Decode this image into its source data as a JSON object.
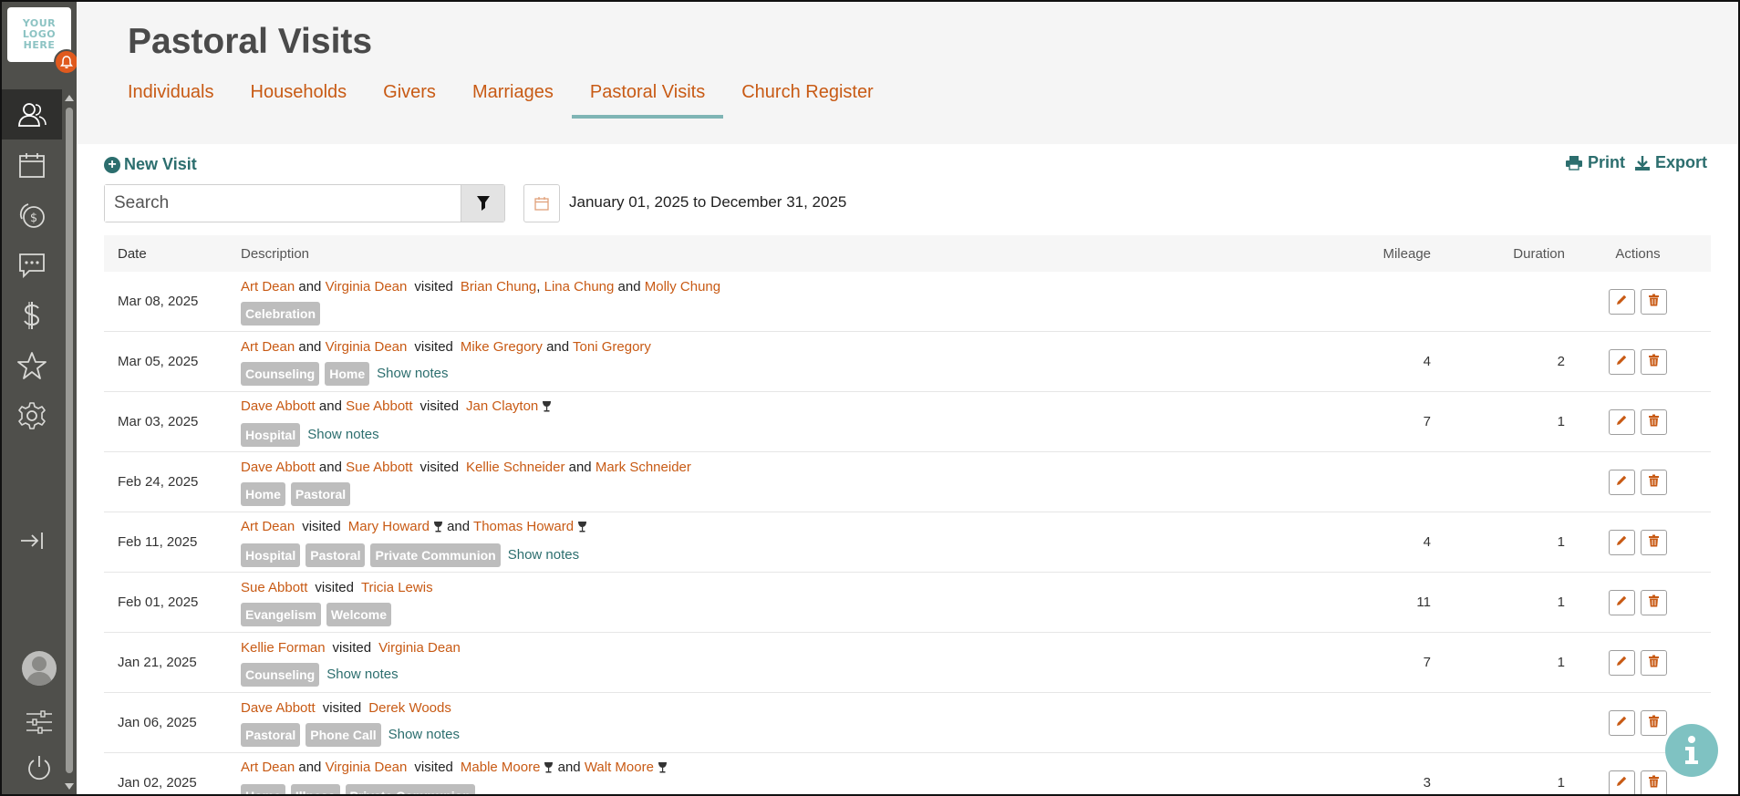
{
  "app": {
    "logo_lines": [
      "YOUR",
      "LOGO",
      "HERE"
    ]
  },
  "sidebar": {
    "items": [
      {
        "name": "people",
        "icon": "people-icon",
        "active": true
      },
      {
        "name": "calendar",
        "icon": "calendar-icon",
        "active": false
      },
      {
        "name": "giving",
        "icon": "coins-icon",
        "active": false
      },
      {
        "name": "messages",
        "icon": "chat-icon",
        "active": false
      },
      {
        "name": "finance",
        "icon": "dollar-icon",
        "active": false
      },
      {
        "name": "favorites",
        "icon": "star-icon",
        "active": false
      },
      {
        "name": "settings",
        "icon": "gear-icon",
        "active": false
      }
    ]
  },
  "header": {
    "title": "Pastoral Visits",
    "tabs": [
      {
        "label": "Individuals",
        "active": false
      },
      {
        "label": "Households",
        "active": false
      },
      {
        "label": "Givers",
        "active": false
      },
      {
        "label": "Marriages",
        "active": false
      },
      {
        "label": "Pastoral Visits",
        "active": true
      },
      {
        "label": "Church Register",
        "active": false
      }
    ]
  },
  "toolbar": {
    "new_visit_label": "New Visit",
    "print_label": "Print",
    "export_label": "Export",
    "search_placeholder": "Search",
    "date_from": "January 01, 2025",
    "date_to_word": "to",
    "date_to": "December 31, 2025"
  },
  "table": {
    "headers": {
      "date": "Date",
      "description": "Description",
      "mileage": "Mileage",
      "duration": "Duration",
      "actions": "Actions"
    },
    "show_notes_label": "Show notes",
    "visited_word": "visited",
    "rows": [
      {
        "date": "Mar 08, 2025",
        "visitors": [
          "Art Dean",
          "Virginia Dean"
        ],
        "visited": [
          {
            "name": "Brian Chung"
          },
          {
            "name": "Lina Chung"
          },
          {
            "name": "Molly Chung"
          }
        ],
        "tags": [
          "Celebration"
        ],
        "notes": false,
        "mileage": "",
        "duration": ""
      },
      {
        "date": "Mar 05, 2025",
        "visitors": [
          "Art Dean",
          "Virginia Dean"
        ],
        "visited": [
          {
            "name": "Mike Gregory"
          },
          {
            "name": "Toni Gregory"
          }
        ],
        "tags": [
          "Counseling",
          "Home"
        ],
        "notes": true,
        "mileage": "4",
        "duration": "2"
      },
      {
        "date": "Mar 03, 2025",
        "visitors": [
          "Dave Abbott",
          "Sue Abbott"
        ],
        "visited": [
          {
            "name": "Jan Clayton",
            "communion": true
          }
        ],
        "tags": [
          "Hospital"
        ],
        "notes": true,
        "mileage": "7",
        "duration": "1"
      },
      {
        "date": "Feb 24, 2025",
        "visitors": [
          "Dave Abbott",
          "Sue Abbott"
        ],
        "visited": [
          {
            "name": "Kellie Schneider"
          },
          {
            "name": "Mark Schneider"
          }
        ],
        "tags": [
          "Home",
          "Pastoral"
        ],
        "notes": false,
        "mileage": "",
        "duration": ""
      },
      {
        "date": "Feb 11, 2025",
        "visitors": [
          "Art Dean"
        ],
        "visited": [
          {
            "name": "Mary Howard",
            "communion": true
          },
          {
            "name": "Thomas Howard",
            "communion": true
          }
        ],
        "tags": [
          "Hospital",
          "Pastoral",
          "Private Communion"
        ],
        "notes": true,
        "mileage": "4",
        "duration": "1"
      },
      {
        "date": "Feb 01, 2025",
        "visitors": [
          "Sue Abbott"
        ],
        "visited": [
          {
            "name": "Tricia Lewis"
          }
        ],
        "tags": [
          "Evangelism",
          "Welcome"
        ],
        "notes": false,
        "mileage": "11",
        "duration": "1"
      },
      {
        "date": "Jan 21, 2025",
        "visitors": [
          "Kellie Forman"
        ],
        "visited": [
          {
            "name": "Virginia Dean"
          }
        ],
        "tags": [
          "Counseling"
        ],
        "notes": true,
        "mileage": "7",
        "duration": "1"
      },
      {
        "date": "Jan 06, 2025",
        "visitors": [
          "Dave Abbott"
        ],
        "visited": [
          {
            "name": "Derek Woods"
          }
        ],
        "tags": [
          "Pastoral",
          "Phone Call"
        ],
        "notes": true,
        "mileage": "",
        "duration": ""
      },
      {
        "date": "Jan 02, 2025",
        "visitors": [
          "Art Dean",
          "Virginia Dean"
        ],
        "visited": [
          {
            "name": "Mable Moore",
            "communion": true
          },
          {
            "name": "Walt Moore",
            "communion": true
          }
        ],
        "tags": [
          "Home",
          "Illness",
          "Private Communion"
        ],
        "notes": false,
        "mileage": "3",
        "duration": "1"
      }
    ]
  },
  "colors": {
    "accent_orange": "#c85a14",
    "accent_teal": "#2c6e6e",
    "sidebar_bg": "#4f4f4b",
    "tab_underline": "#7fb5b5",
    "tag_bg": "#bdbdbd",
    "notification_badge": "#e05a1e"
  }
}
